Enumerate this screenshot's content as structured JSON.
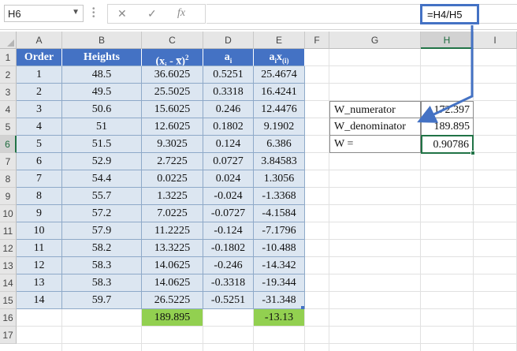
{
  "formula_bar": {
    "name_box": "H6",
    "name_dropdown_icon": "chevron-down-icon",
    "cancel_icon": "✕",
    "enter_icon": "✓",
    "function_icon": "fx",
    "formula": "=H4/H5"
  },
  "columns": [
    "A",
    "B",
    "C",
    "D",
    "E",
    "F",
    "G",
    "H",
    "I"
  ],
  "rows": [
    "1",
    "2",
    "3",
    "4",
    "5",
    "6",
    "7",
    "8",
    "9",
    "10",
    "11",
    "12",
    "13",
    "14",
    "15",
    "16",
    "17"
  ],
  "selected_cell": "H6",
  "table": {
    "headers": {
      "order": "Order",
      "heights": "Heights",
      "c_prefix": "(x",
      "c_sub": "i",
      "c_mid": " - x̅)",
      "c_sup": "2",
      "d_base": "a",
      "d_sub": "i",
      "e_base": "a",
      "e_sub1": "i",
      "e_mid": "x",
      "e_sub2": "(i)"
    },
    "rows": [
      {
        "order": "1",
        "height": "48.5",
        "c": "36.6025",
        "d": "0.5251",
        "e": "25.4674"
      },
      {
        "order": "2",
        "height": "49.5",
        "c": "25.5025",
        "d": "0.3318",
        "e": "16.4241"
      },
      {
        "order": "3",
        "height": "50.6",
        "c": "15.6025",
        "d": "0.246",
        "e": "12.4476"
      },
      {
        "order": "4",
        "height": "51",
        "c": "12.6025",
        "d": "0.1802",
        "e": "9.1902"
      },
      {
        "order": "5",
        "height": "51.5",
        "c": "9.3025",
        "d": "0.124",
        "e": "6.386"
      },
      {
        "order": "6",
        "height": "52.9",
        "c": "2.7225",
        "d": "0.0727",
        "e": "3.84583"
      },
      {
        "order": "7",
        "height": "54.4",
        "c": "0.0225",
        "d": "0.024",
        "e": "1.3056"
      },
      {
        "order": "8",
        "height": "55.7",
        "c": "1.3225",
        "d": "-0.024",
        "e": "-1.3368"
      },
      {
        "order": "9",
        "height": "57.2",
        "c": "7.0225",
        "d": "-0.0727",
        "e": "-4.1584"
      },
      {
        "order": "10",
        "height": "57.9",
        "c": "11.2225",
        "d": "-0.124",
        "e": "-7.1796"
      },
      {
        "order": "11",
        "height": "58.2",
        "c": "13.3225",
        "d": "-0.1802",
        "e": "-10.488"
      },
      {
        "order": "12",
        "height": "58.3",
        "c": "14.0625",
        "d": "-0.246",
        "e": "-14.342"
      },
      {
        "order": "13",
        "height": "58.3",
        "c": "14.0625",
        "d": "-0.3318",
        "e": "-19.344"
      },
      {
        "order": "14",
        "height": "59.7",
        "c": "26.5225",
        "d": "-0.5251",
        "e": "-31.348"
      }
    ],
    "totals": {
      "c": "189.895",
      "e": "-13.13"
    }
  },
  "side_table": [
    {
      "label": "W_numerator",
      "value": "172.397"
    },
    {
      "label": "W_denominator",
      "value": "189.895"
    },
    {
      "label": "W =",
      "value": "0.90786"
    }
  ],
  "colors": {
    "table_header": "#4472c4",
    "table_band": "#dce6f1",
    "total_fill": "#92d050",
    "selection": "#217346",
    "callout_arrow": "#4472c4"
  }
}
